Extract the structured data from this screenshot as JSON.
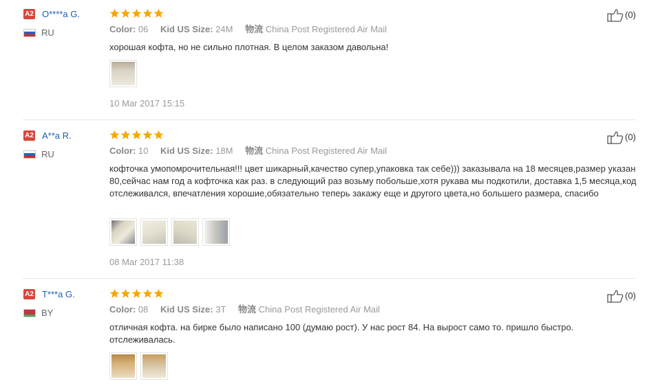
{
  "labels": {
    "color": "Color:",
    "size": "Kid US Size:",
    "logistics": "物流",
    "shipping": "China Post Registered Air Mail"
  },
  "reviews": [
    {
      "badge": "A2",
      "user": "O****a G.",
      "country": "RU",
      "flag": [
        "#ffffff",
        "#2f5fb5",
        "#d52b1e"
      ],
      "rating": 5,
      "color": "06",
      "size": "24M",
      "text": "хорошая кофта, но не сильно плотная. В целом заказом давольна!",
      "photos": [
        "#d8d2c3"
      ],
      "date": "10 Mar 2017 15:15",
      "helpful": "(0)"
    },
    {
      "badge": "A2",
      "user": "A**a R.",
      "country": "RU",
      "flag": [
        "#ffffff",
        "#2f5fb5",
        "#d52b1e"
      ],
      "rating": 5,
      "color": "10",
      "size": "18M",
      "text": "кофточка умопомрочительная!!! цвет шикарный,качество супер,упаковка так себе))) заказывала на 18 месяцев,размер указан 80,сейчас нам год а кофточка как раз. в следующий раз возьму побольше,хотя рукава мы подкотили, доставка 1,5 месяца,код отслеживался, впечатления хорошие,обязательно теперь закажу еще и другого цвета,но большего размера, спасибо",
      "photos": [
        "#d9d4c2",
        "#e4e0cf",
        "#dcd8c6",
        "#c9c7bf"
      ],
      "date": "08 Mar 2017 11:38",
      "helpful": "(0)"
    },
    {
      "badge": "A2",
      "user": "T***a G.",
      "country": "BY",
      "flag": [
        "#c8313e",
        "#c8313e",
        "#4aa657"
      ],
      "rating": 5,
      "color": "08",
      "size": "3T",
      "text": "отличная кофта. на бирке было написано 100 (думаю рост). У нас рост 84. На вырост само то. пришло быстро. отслеживалась.",
      "photos": [
        "#d6b27a",
        "#d9c8a8"
      ],
      "date": "",
      "helpful": "(0)"
    }
  ],
  "colors": {
    "badge": "#d9453c",
    "username": "#1f5bb3",
    "star": "#f7a600",
    "divider": "#e6e6e6"
  }
}
